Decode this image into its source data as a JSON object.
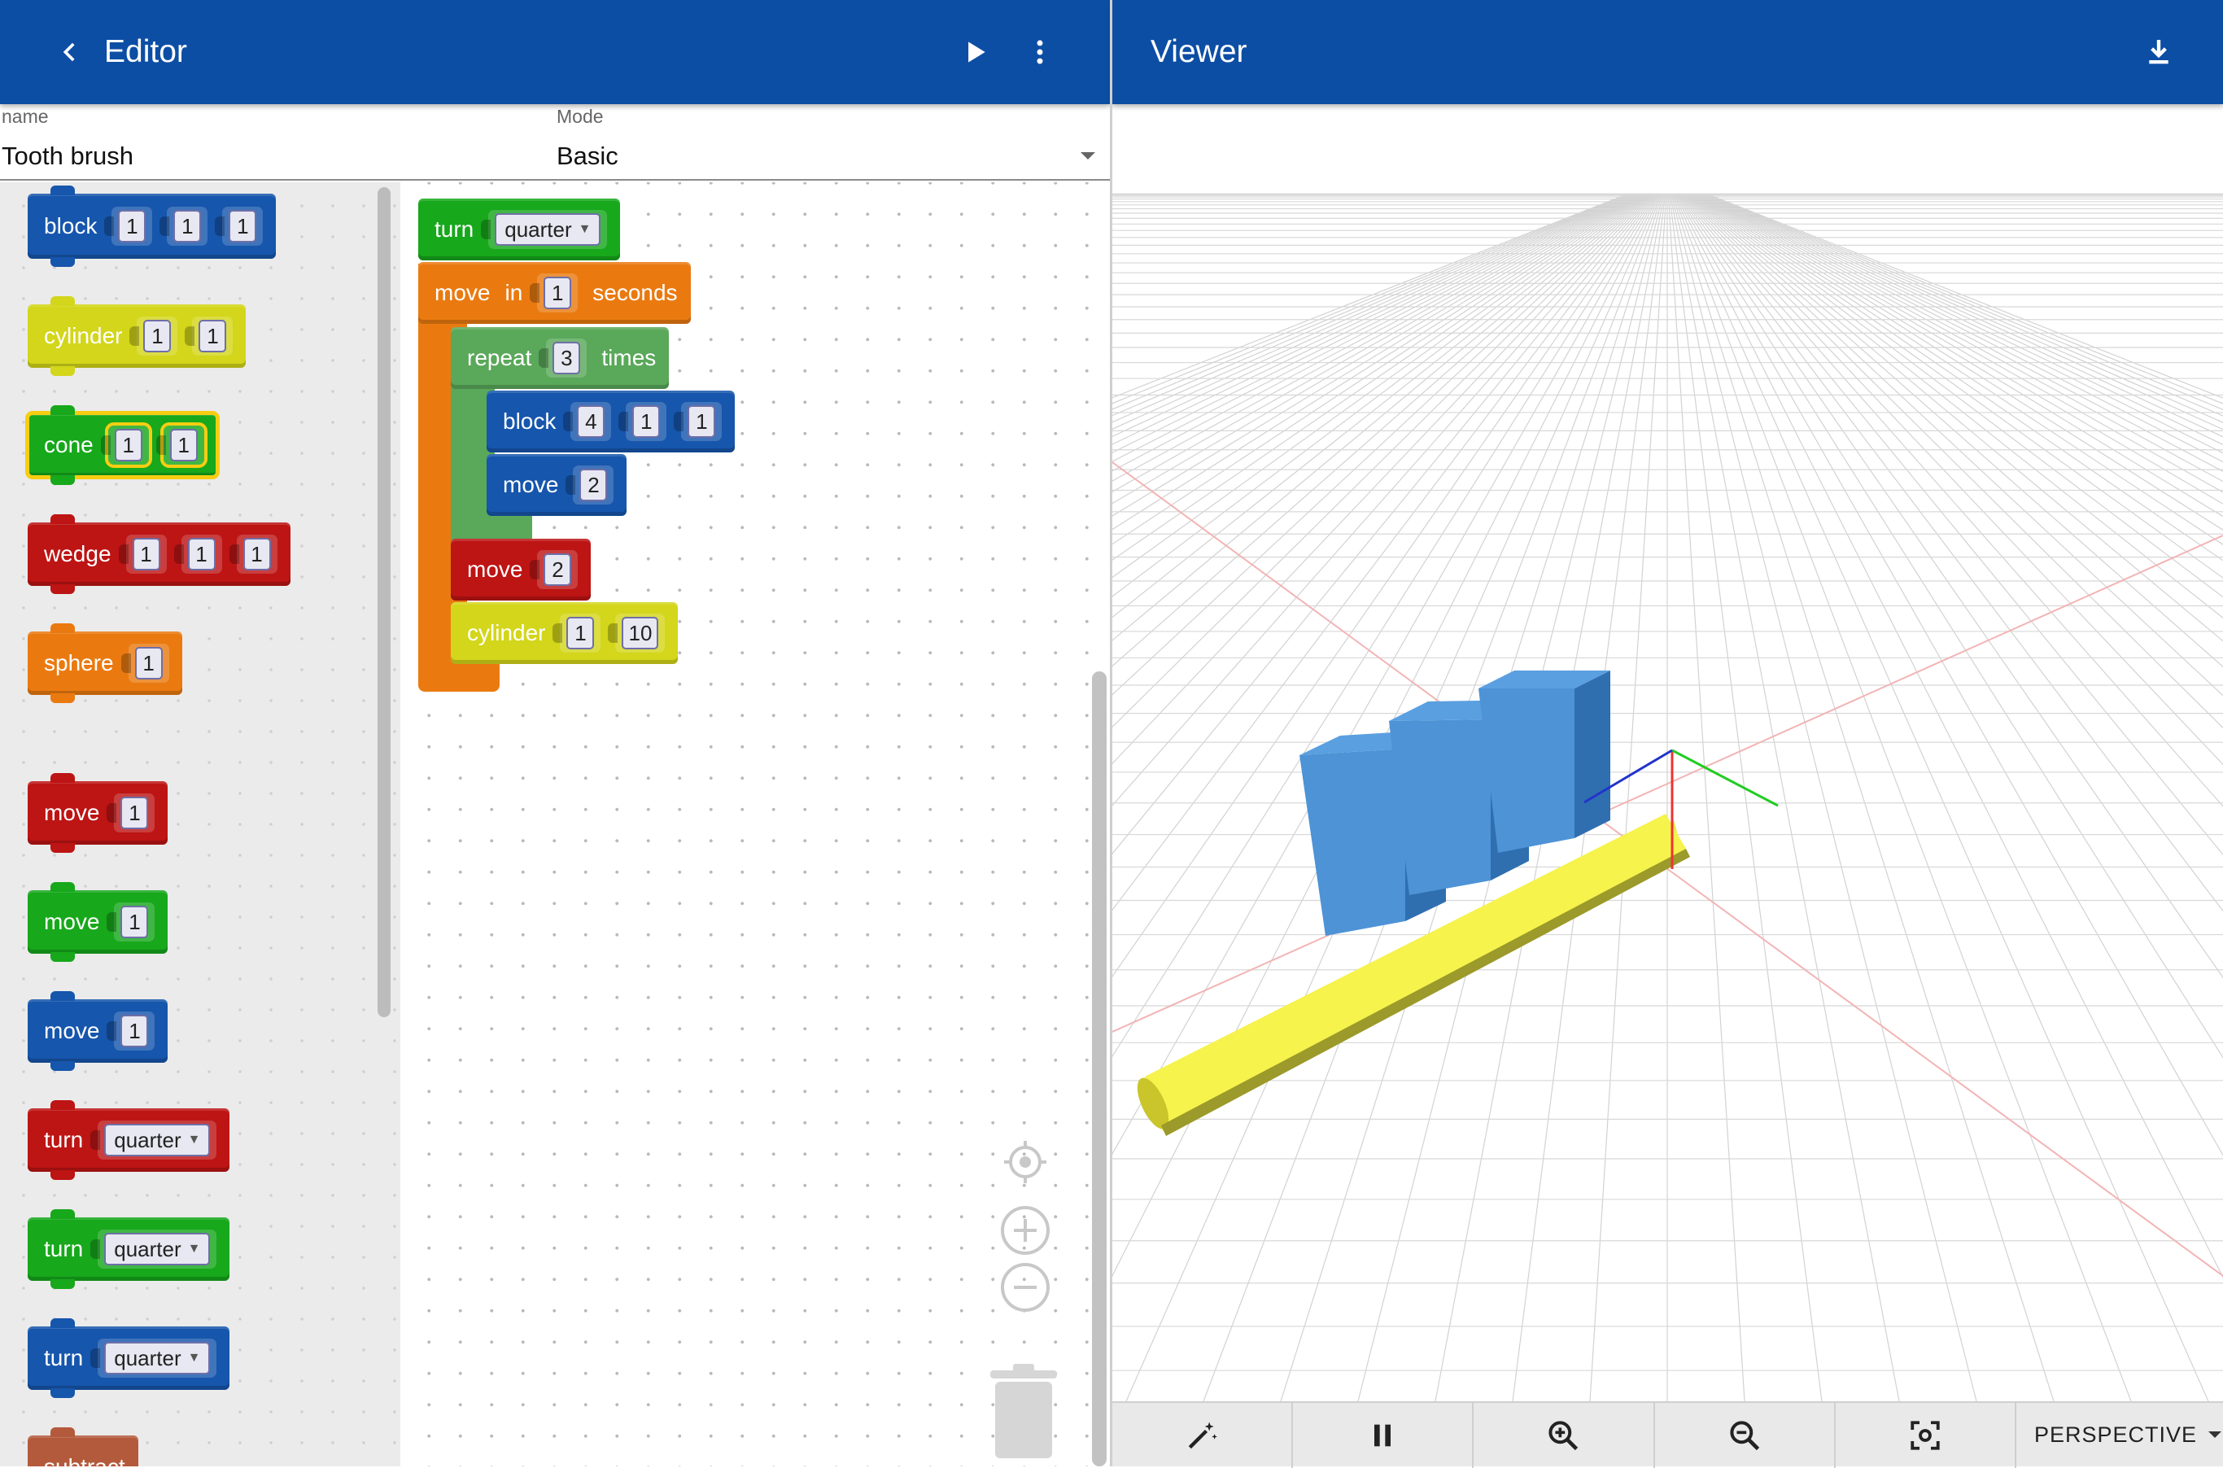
{
  "editor": {
    "title": "Editor",
    "back_icon": "chevron-left-icon",
    "run_icon": "play-icon",
    "menu_icon": "more-vertical-icon"
  },
  "viewer": {
    "title": "Viewer",
    "download_icon": "download-icon",
    "toolbar": {
      "buttons": [
        "magic-wand-icon",
        "pause-icon",
        "zoom-in-icon",
        "zoom-out-icon",
        "focus-icon"
      ],
      "camera_mode": "PERSPECTIVE"
    }
  },
  "form": {
    "name_label": "name",
    "name_value": "Tooth brush",
    "mode_label": "Mode",
    "mode_value": "Basic"
  },
  "toolbox": {
    "blocks": [
      {
        "label": "block",
        "color": "#1656ac",
        "args": [
          "1",
          "1",
          "1"
        ]
      },
      {
        "label": "cylinder",
        "color": "#d3d61a",
        "args": [
          "1",
          "1"
        ]
      },
      {
        "label": "cone",
        "color": "#17a81b",
        "args": [
          "1",
          "1"
        ],
        "selected": true
      },
      {
        "label": "wedge",
        "color": "#bd1414",
        "args": [
          "1",
          "1",
          "1"
        ]
      },
      {
        "label": "sphere",
        "color": "#ea7a10",
        "args": [
          "1"
        ]
      },
      {
        "label": "move",
        "color": "#bd1414",
        "args": [
          "1"
        ]
      },
      {
        "label": "move",
        "color": "#17a81b",
        "args": [
          "1"
        ]
      },
      {
        "label": "move",
        "color": "#1656ac",
        "args": [
          "1"
        ]
      },
      {
        "label": "turn",
        "color": "#bd1414",
        "dropdown": "quarter"
      },
      {
        "label": "turn",
        "color": "#17a81b",
        "dropdown": "quarter"
      },
      {
        "label": "turn",
        "color": "#1656ac",
        "dropdown": "quarter"
      },
      {
        "label": "subtract",
        "color": "#b45a3c"
      }
    ]
  },
  "workspace": {
    "turn": {
      "label": "turn",
      "value": "quarter"
    },
    "move_in": {
      "label": "move",
      "in_label": "in",
      "value": "1",
      "unit": "seconds"
    },
    "repeat": {
      "label": "repeat",
      "value": "3",
      "unit": "times"
    },
    "inner_block": {
      "label": "block",
      "args": [
        "4",
        "1",
        "1"
      ]
    },
    "inner_move": {
      "label": "move",
      "value": "2"
    },
    "move2": {
      "label": "move",
      "value": "2"
    },
    "cylinder": {
      "label": "cylinder",
      "args": [
        "1",
        "10"
      ]
    },
    "controls": [
      "recenter-icon",
      "zoom-in-icon",
      "zoom-out-icon",
      "trash-icon"
    ]
  },
  "colors": {
    "app_bar": "#0d4ea5",
    "shape_blue": "#3f88d0",
    "shape_yellow": "#f4f24a"
  }
}
